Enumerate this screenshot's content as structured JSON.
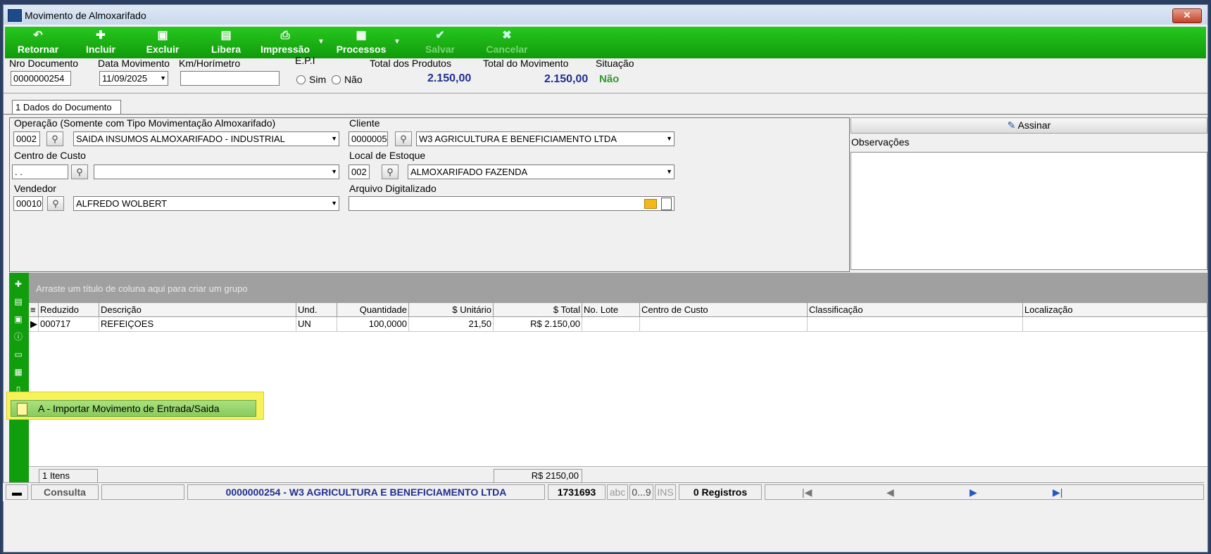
{
  "window": {
    "title": "Movimento de Almoxarifado",
    "close_label": "✕"
  },
  "toolbar": {
    "retornar": "Retornar",
    "incluir": "Incluir",
    "excluir": "Excluir",
    "libera": "Libera",
    "impressao": "Impressão",
    "processos": "Processos",
    "salvar": "Salvar",
    "cancelar": "Cancelar"
  },
  "header": {
    "nro_documento_label": "Nro Documento",
    "nro_documento": "0000000254",
    "data_movimento_label": "Data Movimento",
    "data_movimento": "11/09/2025",
    "km_label": "Km/Horímetro",
    "km_value": "",
    "epi_label": "E.P.I",
    "epi_sim": "Sim",
    "epi_nao": "Não",
    "total_produtos_label": "Total dos Produtos",
    "total_produtos": "2.150,00",
    "total_movimento_label": "Total do Movimento",
    "total_movimento": "2.150,00",
    "situacao_label": "Situação",
    "situacao": "Não"
  },
  "tabs": [
    {
      "label": "1 Dados do Documento"
    }
  ],
  "form": {
    "operacao_label": "Operação (Somente com Tipo Movimentação Almoxarifado)",
    "operacao_code": "0002",
    "operacao_name": "SAIDA INSUMOS ALMOXARIFADO - INDUSTRIAL",
    "cliente_label": "Cliente",
    "cliente_code": "0000005",
    "cliente_name": "W3 AGRICULTURA E BENEFICIAMENTO LTDA",
    "centro_custo_label": "Centro de Custo",
    "centro_custo_code": " .  .",
    "centro_custo_name": "",
    "local_estoque_label": "Local de Estoque",
    "local_estoque_code": "002",
    "local_estoque_name": "ALMOXARIFADO FAZENDA",
    "vendedor_label": "Vendedor",
    "vendedor_code": "00010",
    "vendedor_name": "ALFREDO WOLBERT",
    "arquivo_label": "Arquivo Digitalizado",
    "arquivo_value": ""
  },
  "side": {
    "assinar_label": "Assinar",
    "observacoes_label": "Observações"
  },
  "grid": {
    "group_hint": "Arraste um título de coluna aqui para criar um grupo",
    "columns": [
      "Reduzido",
      "Descrição",
      "Und.",
      "Quantidade",
      "$ Unitário",
      "$ Total",
      "No. Lote",
      "Centro de Custo",
      "Classificação",
      "Localização"
    ],
    "rows": [
      {
        "reduzido": "000717",
        "descricao": "REFEIÇOES",
        "und": "UN",
        "quantidade": "100,0000",
        "unitario": "21,50",
        "total": "R$ 2.150,00",
        "lote": "",
        "centro": "",
        "classificacao": "",
        "localizacao": ""
      }
    ],
    "footer_count": "1 Itens",
    "footer_total": "R$ 2150,00"
  },
  "popup": {
    "item": "A - Importar Movimento de Entrada/Saida"
  },
  "statusbar": {
    "mode": "Consulta",
    "record": "0000000254 - W3 AGRICULTURA E BENEFICIAMENTO LTDA",
    "number": "1731693",
    "abc": "abc",
    "digits": "0...9",
    "ins": "INS",
    "registros": "0 Registros"
  }
}
